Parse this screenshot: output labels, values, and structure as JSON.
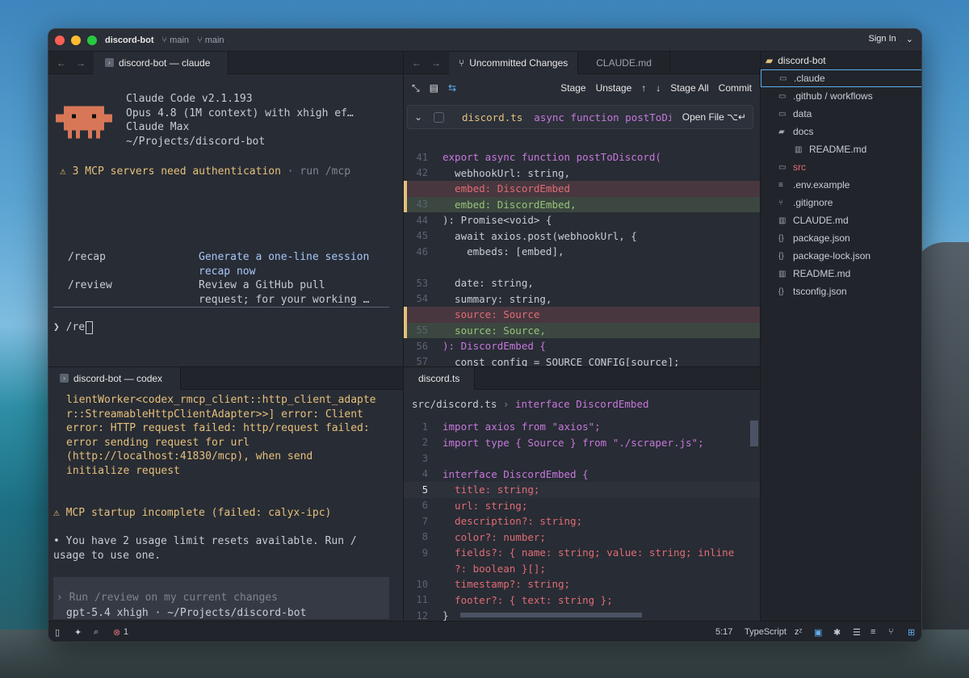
{
  "window": {
    "project": "discord-bot",
    "branch1": "main",
    "branch2": "main",
    "sign_in": "Sign In"
  },
  "claude_pane": {
    "tab_label": "discord-bot — claude",
    "version": "Claude Code v2.1.193",
    "model": "Opus 4.8 (1M context) with xhigh ef…",
    "plan": "Claude Max",
    "path": "~/Projects/discord-bot",
    "warning": "⚠ 3 MCP servers need authentication",
    "warning_suffix": " · run /mcp",
    "commands": [
      {
        "cmd": "/recap",
        "desc1": "Generate a one-line session",
        "desc2": "recap now"
      },
      {
        "cmd": "/review",
        "desc1": "Review a GitHub pull",
        "desc2": "request; for your working …"
      }
    ],
    "prompt": "❯ /re"
  },
  "codex_pane": {
    "tab_label": "discord-bot — codex",
    "error_lines": [
      "lientWorker<codex_rmcp_client::http_client_adapte",
      "r::StreamableHttpClientAdapter>>] error: Client",
      "error: HTTP request failed: http/request failed:",
      "error sending request for url",
      "(http://localhost:41830/mcp), when send",
      "initialize request"
    ],
    "mcp_warning": "⚠ MCP startup incomplete (failed: calyx-ipc)",
    "usage_line1": "• You have 2 usage limit resets available. Run /",
    "usage_line2": "usage to use one.",
    "input_placeholder": "Run /review on my current changes",
    "footer": "gpt-5.4 xhigh · ~/Projects/discord-bot"
  },
  "diff_pane": {
    "tabs": [
      "Uncommitted Changes",
      "CLAUDE.md"
    ],
    "toolbar": {
      "stage": "Stage",
      "unstage": "Unstage",
      "stage_all": "Stage All",
      "commit": "Commit"
    },
    "file_name": "discord.ts",
    "file_context": "async function postToDi",
    "open_file": "Open File ⌥↵",
    "lines": [
      {
        "n": "41",
        "text": "export async function postToDiscord(",
        "kind": "ctx"
      },
      {
        "n": "42",
        "text": "  webhookUrl: string,",
        "kind": "ctx"
      },
      {
        "n": "",
        "text": "  embed: DiscordEmbed",
        "kind": "del"
      },
      {
        "n": "43",
        "text": "  embed: DiscordEmbed,",
        "kind": "add"
      },
      {
        "n": "44",
        "text": "): Promise<void> {",
        "kind": "ctx"
      },
      {
        "n": "45",
        "text": "  await axios.post(webhookUrl, {",
        "kind": "ctx"
      },
      {
        "n": "46",
        "text": "    embeds: [embed],",
        "kind": "ctx"
      },
      {
        "n": "",
        "text": "",
        "kind": "gap"
      },
      {
        "n": "53",
        "text": "  date: string,",
        "kind": "ctx"
      },
      {
        "n": "54",
        "text": "  summary: string,",
        "kind": "ctx"
      },
      {
        "n": "",
        "text": "  source: Source",
        "kind": "del"
      },
      {
        "n": "55",
        "text": "  source: Source,",
        "kind": "add"
      },
      {
        "n": "56",
        "text": "): DiscordEmbed {",
        "kind": "ctx"
      },
      {
        "n": "57",
        "text": "  const config = SOURCE_CONFIG[source];",
        "kind": "ctx"
      }
    ]
  },
  "editor_pane": {
    "tab_label": "discord.ts",
    "breadcrumb_file": "src/discord.ts",
    "breadcrumb_symbol": "interface DiscordEmbed",
    "lines": [
      {
        "n": "1",
        "text": "import axios from \"axios\";"
      },
      {
        "n": "2",
        "text": "import type { Source } from \"./scraper.js\";"
      },
      {
        "n": "3",
        "text": ""
      },
      {
        "n": "4",
        "text": "interface DiscordEmbed {"
      },
      {
        "n": "5",
        "text": "  title: string;"
      },
      {
        "n": "6",
        "text": "  url: string;"
      },
      {
        "n": "7",
        "text": "  description?: string;"
      },
      {
        "n": "8",
        "text": "  color?: number;"
      },
      {
        "n": "9",
        "text": "  fields?: { name: string; value: string; inline"
      },
      {
        "n": "",
        "text": "  ?: boolean }[];"
      },
      {
        "n": "10",
        "text": "  timestamp?: string;"
      },
      {
        "n": "11",
        "text": "  footer?: { text: string };"
      },
      {
        "n": "12",
        "text": "}"
      }
    ]
  },
  "sidebar": {
    "root": "discord-bot",
    "items": [
      {
        "name": ".claude",
        "icon": "folder-icon",
        "depth": 1
      },
      {
        "name": ".github / workflows",
        "icon": "folder-icon",
        "depth": 1
      },
      {
        "name": "data",
        "icon": "folder-icon",
        "depth": 1
      },
      {
        "name": "docs",
        "icon": "folder-open-icon",
        "depth": 1
      },
      {
        "name": "README.md",
        "icon": "book-icon",
        "depth": 2
      },
      {
        "name": "src",
        "icon": "folder-modified-icon",
        "depth": 1
      },
      {
        "name": ".env.example",
        "icon": "file-icon",
        "depth": 1
      },
      {
        "name": ".gitignore",
        "icon": "git-icon",
        "depth": 1
      },
      {
        "name": "CLAUDE.md",
        "icon": "book-icon",
        "depth": 1
      },
      {
        "name": "package.json",
        "icon": "braces-icon",
        "depth": 1
      },
      {
        "name": "package-lock.json",
        "icon": "braces-icon",
        "depth": 1
      },
      {
        "name": "README.md",
        "icon": "book-icon",
        "depth": 1
      },
      {
        "name": "tsconfig.json",
        "icon": "braces-icon",
        "depth": 1
      }
    ]
  },
  "statusbar": {
    "errors": "1",
    "position": "5:17",
    "language": "TypeScript"
  },
  "colors": {
    "accent": "#61afef",
    "added": "#98c379",
    "removed": "#e06c75",
    "warning": "#e5c07b"
  }
}
